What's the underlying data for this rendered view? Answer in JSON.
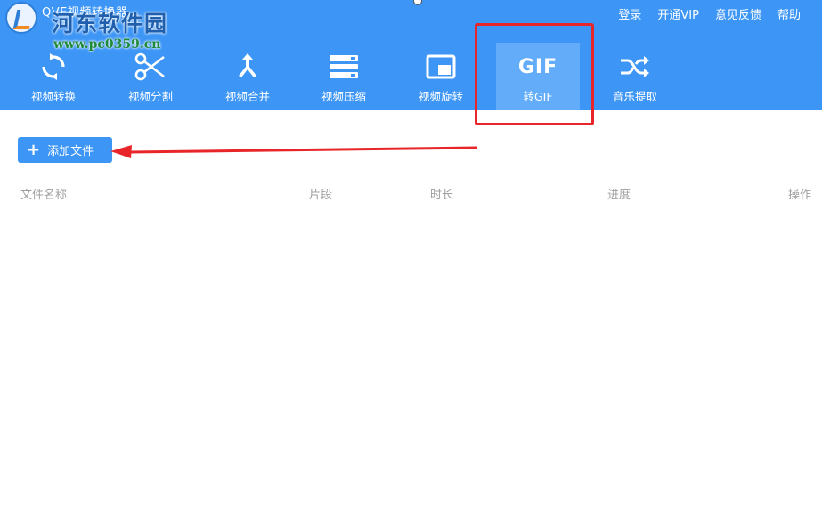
{
  "app": {
    "title": "QVE视频转换器",
    "watermark": "河东软件园",
    "watermark_url": "www.pc0359.cn"
  },
  "top_links": [
    {
      "label": "登录"
    },
    {
      "label": "开通VIP"
    },
    {
      "label": "意见反馈"
    },
    {
      "label": "帮助"
    }
  ],
  "tools": [
    {
      "label": "视频转换",
      "icon": "refresh-icon"
    },
    {
      "label": "视频分割",
      "icon": "scissors-icon"
    },
    {
      "label": "视频合并",
      "icon": "merge-icon"
    },
    {
      "label": "视频压缩",
      "icon": "compress-icon"
    },
    {
      "label": "视频旋转",
      "icon": "rotate-icon"
    },
    {
      "label": "转GIF",
      "icon": "gif-icon",
      "icon_text": "GIF",
      "active": true
    },
    {
      "label": "音乐提取",
      "icon": "shuffle-icon"
    }
  ],
  "add_file": {
    "label": "添加文件",
    "icon": "plus-icon"
  },
  "table": {
    "columns": [
      "文件名称",
      "片段",
      "时长",
      "进度",
      "操作"
    ],
    "rows": []
  },
  "colors": {
    "accent": "#3d96f6",
    "active_tab": "#62acfa",
    "annotation": "#e8262a"
  }
}
